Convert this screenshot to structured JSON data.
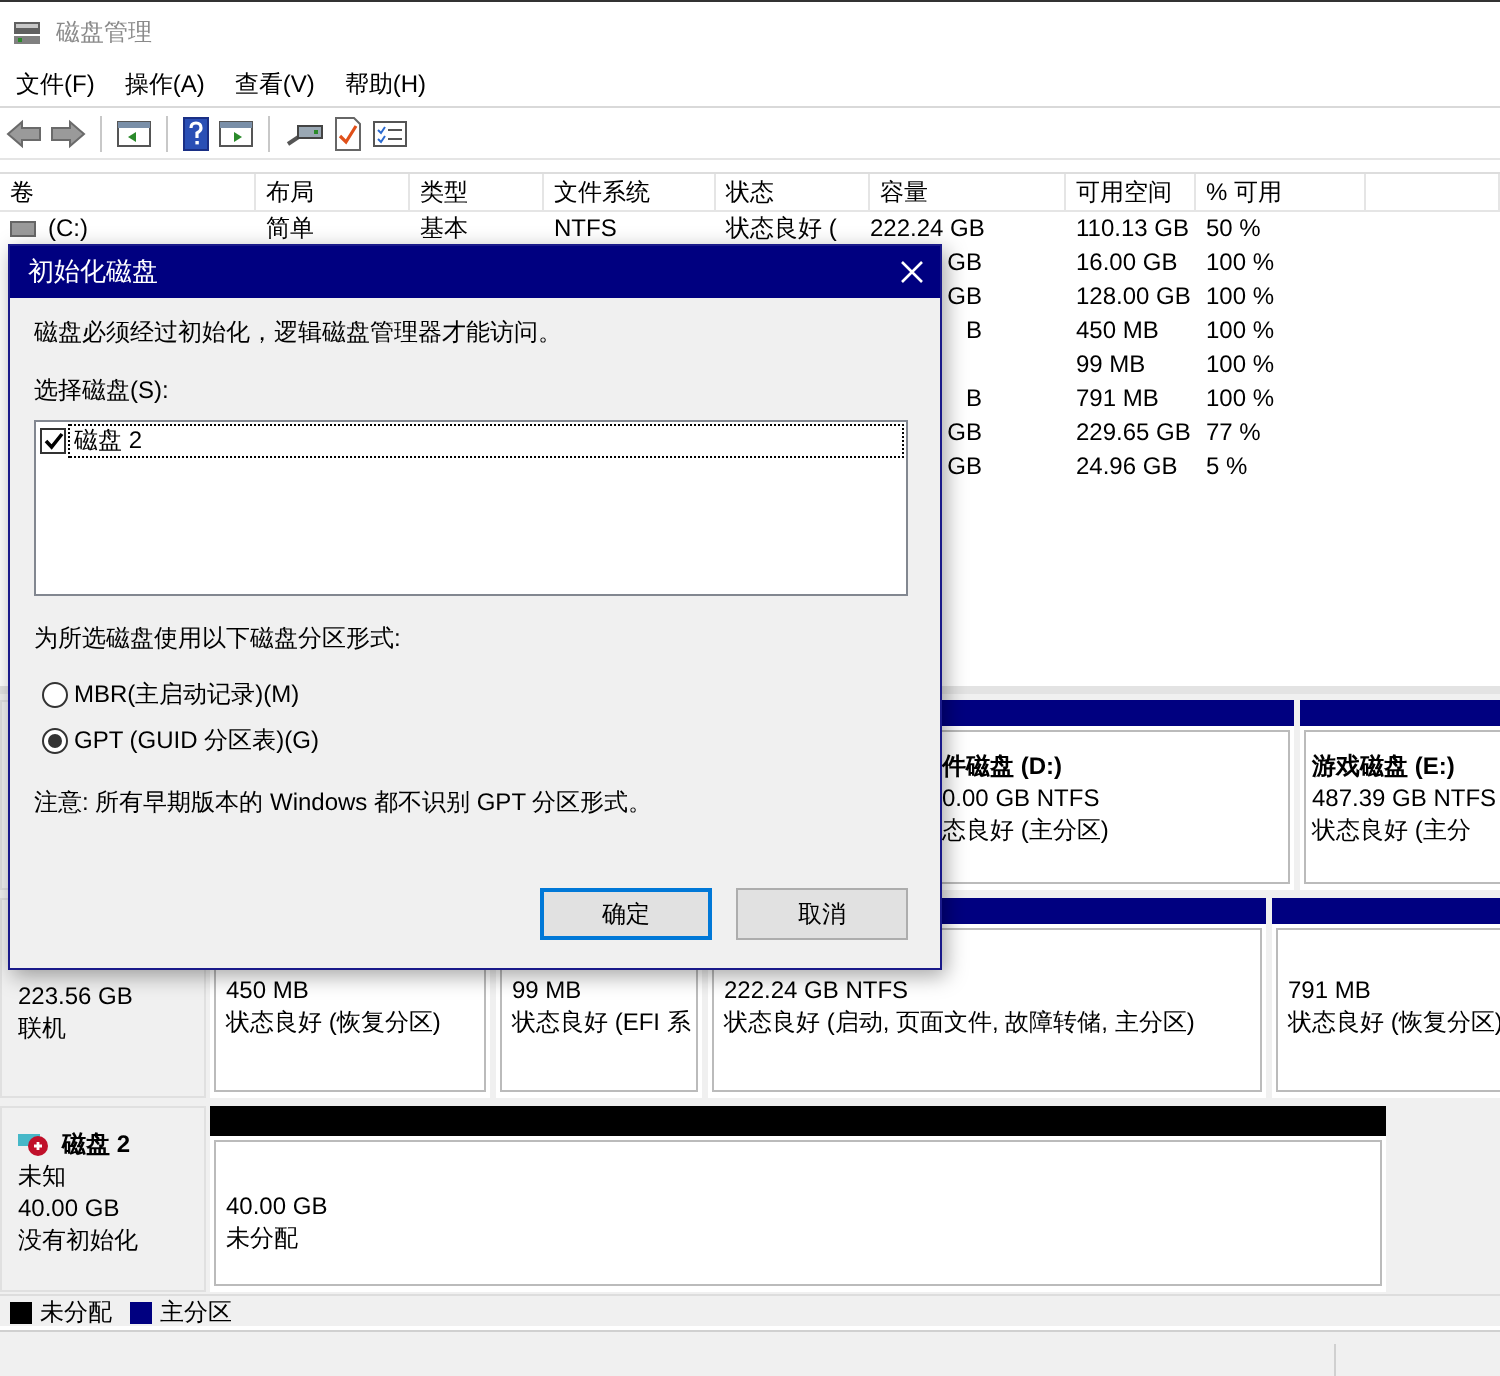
{
  "window": {
    "title": "磁盘管理"
  },
  "menu": [
    "文件(F)",
    "操作(A)",
    "查看(V)",
    "帮助(H)"
  ],
  "volume_table": {
    "columns": [
      "卷",
      "布局",
      "类型",
      "文件系统",
      "状态",
      "容量",
      "可用空间",
      "% 可用"
    ],
    "rows": [
      {
        "volume": "(C:)",
        "layout": "简单",
        "type": "基本",
        "file_system": "NTFS",
        "status": "状态良好 (",
        "capacity": "222.24 GB",
        "free_space": "110.13 GB",
        "percent_free": "50 %"
      },
      {
        "capacity": "GB",
        "free_space": "16.00 GB",
        "percent_free": "100 %"
      },
      {
        "capacity": "GB",
        "free_space": "128.00 GB",
        "percent_free": "100 %"
      },
      {
        "capacity": "B",
        "free_space": "450 MB",
        "percent_free": "100 %"
      },
      {
        "free_space": "99 MB",
        "percent_free": "100 %"
      },
      {
        "capacity": "B",
        "free_space": "791 MB",
        "percent_free": "100 %"
      },
      {
        "capacity": "GB",
        "free_space": "229.65 GB",
        "percent_free": "77 %"
      },
      {
        "capacity": "GB",
        "free_space": "24.96 GB",
        "percent_free": "5 %"
      }
    ]
  },
  "disks": [
    {
      "partitions": [
        {
          "kind": "primary",
          "name": "件磁盘 (D:)",
          "size": "0.00 GB NTFS",
          "status": "态良好 (主分区)"
        },
        {
          "kind": "primary",
          "name": "游戏磁盘 (E:)",
          "size": "487.39 GB NTFS",
          "status": "状态良好 (主分"
        }
      ]
    },
    {
      "label": {
        "lines": [
          "223.56 GB",
          "联机"
        ]
      },
      "partitions": [
        {
          "size": "450 MB",
          "status": "状态良好 (恢复分区)"
        },
        {
          "size": "99 MB",
          "status": "状态良好 (EFI 系"
        },
        {
          "kind": "primary",
          "size": "222.24 GB NTFS",
          "status": "状态良好 (启动, 页面文件, 故障转储, 主分区)"
        },
        {
          "kind": "primary",
          "size": "791 MB",
          "status": "状态良好 (恢复分区)"
        }
      ]
    },
    {
      "label": {
        "name": "磁盘 2",
        "lines": [
          "未知",
          "40.00 GB",
          "没有初始化"
        ]
      },
      "partitions": [
        {
          "kind": "unallocated",
          "size": "40.00 GB",
          "status": "未分配"
        }
      ]
    }
  ],
  "legend": [
    {
      "label": "未分配",
      "color": "#000000"
    },
    {
      "label": "主分区",
      "color": "#000080"
    }
  ],
  "dialog": {
    "title": "初始化磁盘",
    "message": "磁盘必须经过初始化，逻辑磁盘管理器才能访问。",
    "disk_list_label": "选择磁盘(S):",
    "disks": [
      {
        "label": "磁盘 2",
        "checked": true
      }
    ],
    "partition_style_label": "为所选磁盘使用以下磁盘分区形式:",
    "partition_styles": [
      {
        "label": "MBR(主启动记录)(M)",
        "selected": false
      },
      {
        "label": "GPT (GUID 分区表)(G)",
        "selected": true
      }
    ],
    "note": "注意: 所有早期版本的 Windows 都不识别 GPT 分区形式。",
    "buttons": [
      {
        "label": "确定",
        "default": true
      },
      {
        "label": "取消",
        "default": false
      }
    ]
  }
}
